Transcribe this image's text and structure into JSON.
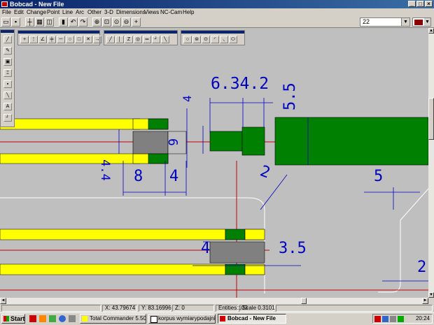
{
  "window": {
    "title": "Bobcad - New File"
  },
  "menu": [
    "File",
    "Edit",
    "Change",
    "Point",
    "Line",
    "Arc",
    "Other",
    "3-D",
    "Dimensions",
    "Views",
    "NC-Cam",
    "Help"
  ],
  "toolbar": {
    "layer_value": "22",
    "current_color": "#8b0000"
  },
  "drawing": {
    "dimensions": {
      "d_6_34_2": "6.34.2",
      "d_5_5": "5.5",
      "d_4_top": "4",
      "d_4_4": "4.4",
      "d_6": "6",
      "d_8": "8",
      "d_4_bottom": "4",
      "d_2_mid": "2",
      "d_5": "5",
      "d_4_lower": "4",
      "d_3_5": "3.5",
      "d_2_right": "2"
    },
    "colors": {
      "background": "#bfbfbf",
      "part_yellow": "#ffff00",
      "part_green": "#008000",
      "part_gray": "#808080",
      "dimension_blue": "#0000c0",
      "centerline_red": "#c00000",
      "outline_white": "#ffffff"
    }
  },
  "status": {
    "x": "X: 43.79674",
    "y": "Y: 83.16996",
    "z": "Z: 0",
    "entities": "Entities:103",
    "scale": "Scale 0.3101"
  },
  "taskbar": {
    "start": "Start",
    "tasks": [
      "Total Commander 5.50 - ...",
      "korpus wymiarypodajnik....",
      "Bobcad - New File"
    ],
    "clock": "20:24"
  }
}
